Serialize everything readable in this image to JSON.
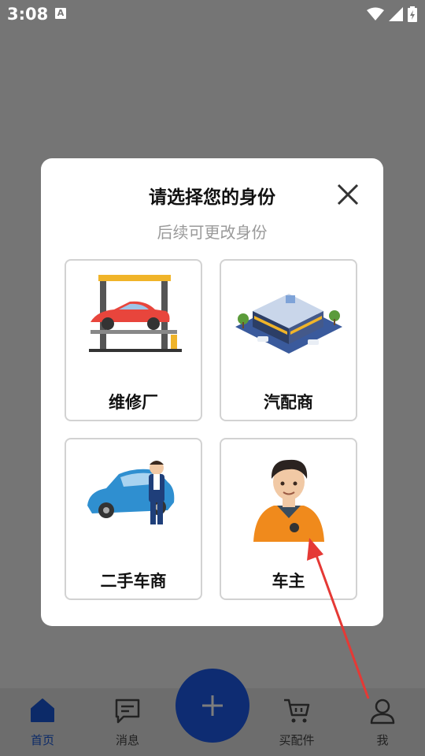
{
  "status_bar": {
    "time": "3:08",
    "notification_icon": "A"
  },
  "dialog": {
    "title": "请选择您的身份",
    "subtitle": "后续可更改身份",
    "roles": [
      {
        "label": "维修厂",
        "icon": "car-lift-icon"
      },
      {
        "label": "汽配商",
        "icon": "auto-parts-store-icon"
      },
      {
        "label": "二手车商",
        "icon": "used-car-dealer-icon"
      },
      {
        "label": "车主",
        "icon": "car-owner-icon"
      }
    ]
  },
  "bottom_nav": {
    "items": [
      {
        "label": "首页",
        "icon": "home-icon",
        "active": true
      },
      {
        "label": "消息",
        "icon": "message-icon",
        "active": false
      },
      {
        "label": "买配件",
        "icon": "cart-icon",
        "active": false
      },
      {
        "label": "我",
        "icon": "user-icon",
        "active": false
      }
    ]
  },
  "colors": {
    "accent": "#0e2c72",
    "overlay": "#757575",
    "arrow": "#e53935"
  }
}
